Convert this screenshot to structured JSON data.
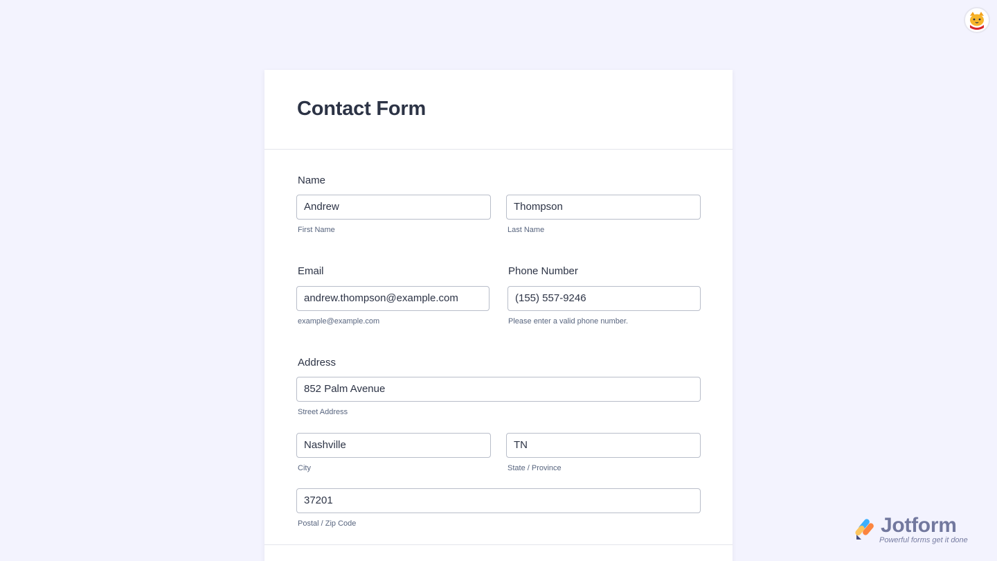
{
  "form": {
    "title": "Contact Form",
    "name": {
      "label": "Name",
      "first": {
        "value": "Andrew",
        "sublabel": "First Name"
      },
      "last": {
        "value": "Thompson",
        "sublabel": "Last Name"
      }
    },
    "email": {
      "label": "Email",
      "value": "andrew.thompson@example.com",
      "sublabel": "example@example.com"
    },
    "phone": {
      "label": "Phone Number",
      "value": "(155) 557-9246",
      "sublabel": "Please enter a valid phone number."
    },
    "address": {
      "label": "Address",
      "street": {
        "value": "852 Palm Avenue",
        "sublabel": "Street Address"
      },
      "city": {
        "value": "Nashville",
        "sublabel": "City"
      },
      "state": {
        "value": "TN",
        "sublabel": "State / Province"
      },
      "zip": {
        "value": "37201",
        "sublabel": "Postal / Zip Code"
      }
    }
  },
  "branding": {
    "name": "Jotform",
    "tagline": "Powerful forms get it done"
  },
  "icons": {
    "avatar": "cat-avatar-icon",
    "brand_logo": "jotform-logo-icon"
  },
  "colors": {
    "background": "#f3f3fe",
    "text": "#2c3345",
    "input_border": "#b8bdc9",
    "sublabel": "#57647e"
  }
}
